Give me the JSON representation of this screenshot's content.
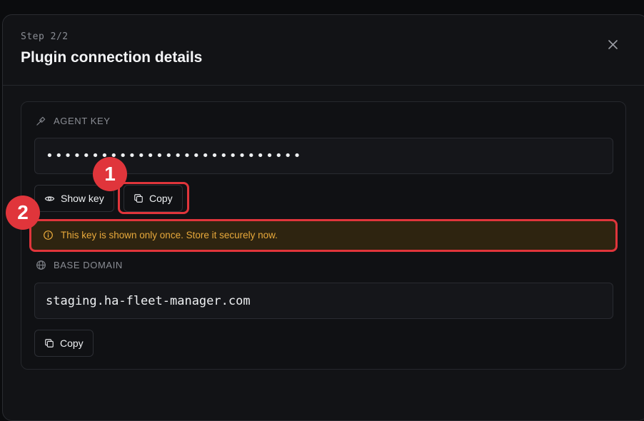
{
  "header": {
    "step": "Step 2/2",
    "title": "Plugin connection details",
    "close_icon": "close-icon"
  },
  "agent_key": {
    "label": "AGENT KEY",
    "icon": "key-icon",
    "value": "••••••••••••••••••••••••••••",
    "show_label": "Show key",
    "copy_label": "Copy"
  },
  "warning": {
    "text": "This key is shown only once. Store it securely now.",
    "icon": "info-icon",
    "color": "#e8a93b"
  },
  "base_domain": {
    "label": "BASE DOMAIN",
    "icon": "globe-icon",
    "value": "staging.ha-fleet-manager.com",
    "copy_label": "Copy"
  },
  "annotations": {
    "badge_1": "1",
    "badge_2": "2",
    "color": "#e0353b"
  }
}
